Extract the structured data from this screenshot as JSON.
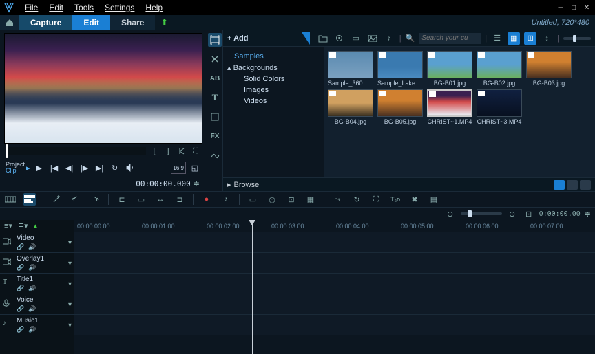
{
  "menu": {
    "items": [
      "File",
      "Edit",
      "Tools",
      "Settings",
      "Help"
    ]
  },
  "tabs": {
    "capture": "Capture",
    "edit": "Edit",
    "share": "Share"
  },
  "document": {
    "title": "Untitled, 720*480"
  },
  "preview": {
    "project_label": "Project",
    "clip_label": "Clip",
    "timecode": "00:00:00.000",
    "aspect": "16:9"
  },
  "sidetools": [
    "media",
    "swap",
    "transition",
    "text-AB",
    "title-T",
    "graphic",
    "filter-FX",
    "path"
  ],
  "library": {
    "add_label": "+ Add",
    "search_placeholder": "Search your cu",
    "tree": {
      "samples": "Samples",
      "backgrounds": "Backgrounds",
      "solid": "Solid Colors",
      "images": "Images",
      "videos": "Videos"
    },
    "items": [
      {
        "name": "Sample_360.mp4",
        "cls": "th-pano"
      },
      {
        "name": "Sample_Lake.m..",
        "cls": "th-sky"
      },
      {
        "name": "BG-B01.jpg",
        "cls": "th-grass"
      },
      {
        "name": "BG-B02.jpg",
        "cls": "th-grass"
      },
      {
        "name": "BG-B03.jpg",
        "cls": "th-sunset"
      },
      {
        "name": "BG-B04.jpg",
        "cls": "th-mnt"
      },
      {
        "name": "BG-B05.jpg",
        "cls": "th-sunset"
      },
      {
        "name": "CHRIST~1.MP4",
        "cls": "th-snow",
        "selected": true
      },
      {
        "name": "CHRIST~3.MP4",
        "cls": "th-xmas"
      }
    ],
    "browse": "Browse"
  },
  "zoom": {
    "timecode": "0:00:00.00"
  },
  "ruler": [
    "00:00:00.00",
    "00:00:01.00",
    "00:00:02.00",
    "00:00:03.00",
    "00:00:04.00",
    "00:00:05.00",
    "00:00:06.00",
    "00:00:07.00"
  ],
  "tracks": [
    {
      "name": "Video",
      "icon": "video"
    },
    {
      "name": "Overlay1",
      "icon": "video"
    },
    {
      "name": "Title1",
      "icon": "title"
    },
    {
      "name": "Voice",
      "icon": "voice"
    },
    {
      "name": "Music1",
      "icon": "music"
    }
  ]
}
